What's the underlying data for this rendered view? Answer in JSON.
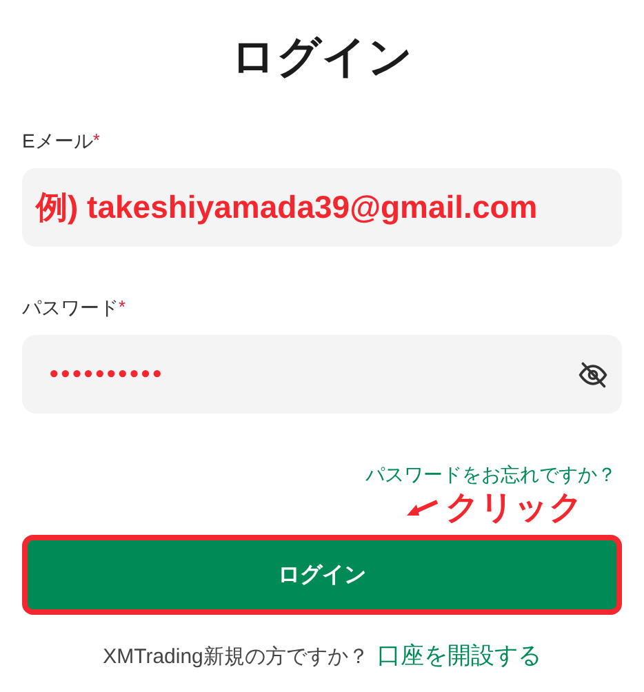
{
  "title": "ログイン",
  "email": {
    "label": "Eメール",
    "required_mark": "*",
    "value": "例) takeshiyamada39@gmail.com"
  },
  "password": {
    "label": "パスワード",
    "required_mark": "*",
    "value": "••••••••••",
    "visible": false
  },
  "forgot_link": "パスワードをお忘れですか？",
  "annotation": {
    "text": "クリック"
  },
  "login_button": {
    "label": "ログイン",
    "highlighted": true
  },
  "footer": {
    "text": "XMTrading新規の方ですか？",
    "link": "口座を開設する"
  }
}
